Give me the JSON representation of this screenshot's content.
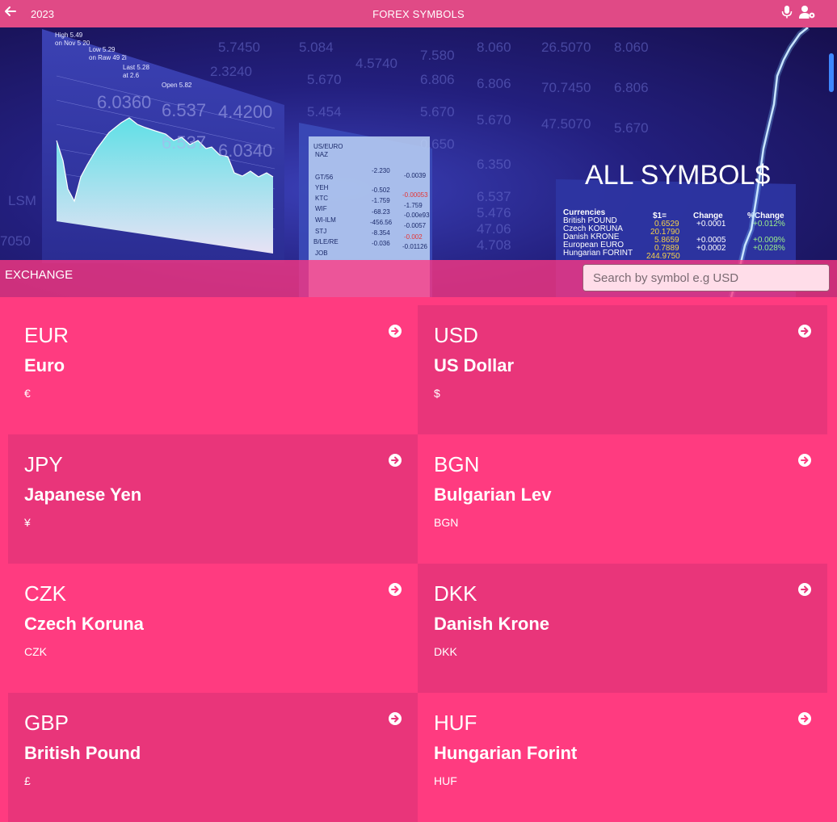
{
  "header": {
    "year": "2023",
    "title": "FOREX SYMBOLS",
    "icons": [
      "arrow-left-icon",
      "microphone-icon",
      "user-gear-icon"
    ]
  },
  "hero": {
    "headline": "ALL SYMBOL$",
    "board_texts": [
      "US/EURO",
      "NAZ",
      "GT/56",
      "YEH",
      "KTC",
      "WIF",
      "WI-ILM",
      "STJ",
      "B/LE/RE",
      "JOB"
    ],
    "currencies_table": {
      "headers": [
        "Currencies",
        "$1=",
        "Change",
        "%Change"
      ],
      "rows": [
        [
          "British POUND",
          "0.6529",
          "+0.0001",
          "+0.012%"
        ],
        [
          "Czech KORUNA",
          "20.1790",
          "",
          ""
        ],
        [
          "Danish KRONE",
          "5.8659",
          "+0.0005",
          "+0.009%"
        ],
        [
          "European EURO",
          "0.7889",
          "+0.0002",
          "+0.028%"
        ],
        [
          "Hungarian FORINT",
          "244.9750",
          "",
          ""
        ]
      ]
    }
  },
  "exchange": {
    "label": "EXCHANGE",
    "search_placeholder": "Search by symbol e.g USD"
  },
  "currencies": [
    {
      "code": "EUR",
      "name": "Euro",
      "symbol": "€"
    },
    {
      "code": "USD",
      "name": "US Dollar",
      "symbol": "$"
    },
    {
      "code": "JPY",
      "name": "Japanese Yen",
      "symbol": "¥"
    },
    {
      "code": "BGN",
      "name": "Bulgarian Lev",
      "symbol": "BGN"
    },
    {
      "code": "CZK",
      "name": "Czech Koruna",
      "symbol": "CZK"
    },
    {
      "code": "DKK",
      "name": "Danish Krone",
      "symbol": "DKK"
    },
    {
      "code": "GBP",
      "name": "British Pound",
      "symbol": "£"
    },
    {
      "code": "HUF",
      "name": "Hungarian Forint",
      "symbol": "HUF"
    }
  ],
  "colors": {
    "header_bg": "#e04a86",
    "card_primary": "#ff3b80",
    "card_alt": "#e9357a",
    "hero_dark": "#160f4d"
  }
}
